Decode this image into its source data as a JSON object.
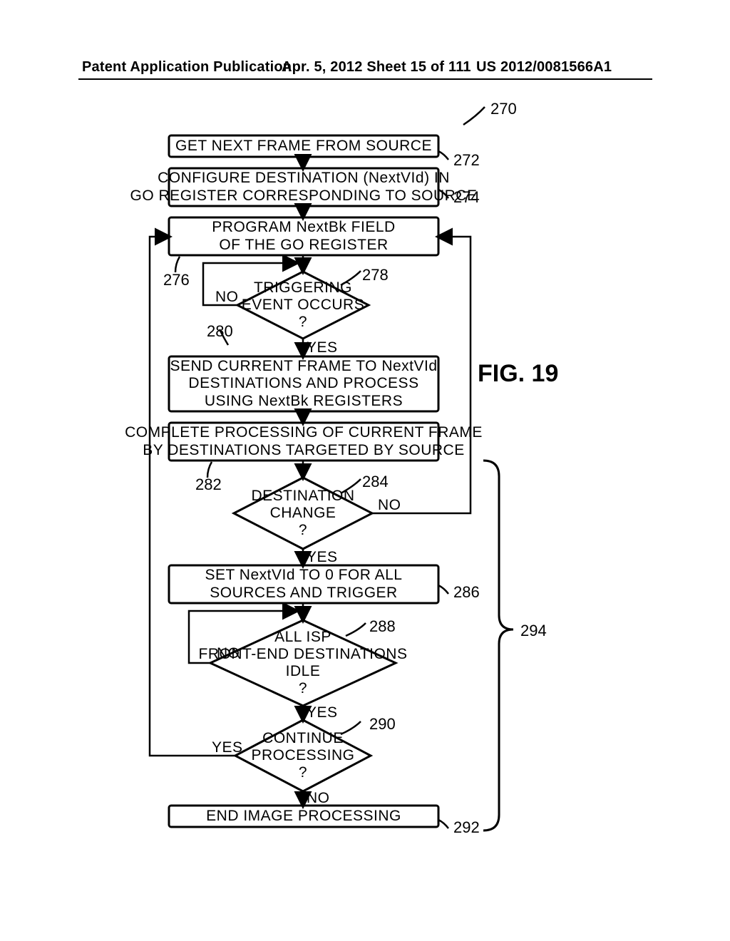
{
  "header": {
    "left": "Patent Application Publication",
    "mid": "Apr. 5, 2012  Sheet 15 of 111",
    "right": "US 2012/0081566A1"
  },
  "figure_label": "FIG. 19",
  "refs": {
    "r270": "270",
    "r272": "272",
    "r274": "274",
    "r276": "276",
    "r278": "278",
    "r280": "280",
    "r282": "282",
    "r284": "284",
    "r286": "286",
    "r288": "288",
    "r290": "290",
    "r292": "292",
    "r294": "294"
  },
  "steps": {
    "s272": "GET NEXT FRAME FROM SOURCE",
    "s274": "CONFIGURE DESTINATION (NextVId) IN\nGO REGISTER CORRESPONDING TO SOURCE",
    "s276": "PROGRAM NextBk FIELD\nOF THE GO REGISTER",
    "d278": "TRIGGERING\nEVENT OCCURS\n?",
    "s280": "SEND CURRENT FRAME TO NextVId\nDESTINATIONS AND PROCESS\nUSING NextBk REGISTERS",
    "s282": "COMPLETE PROCESSING OF CURRENT FRAME\nBY DESTINATIONS TARGETED BY SOURCE",
    "d284": "DESTINATION\nCHANGE\n?",
    "s286": "SET NextVId TO 0 FOR ALL\nSOURCES AND TRIGGER",
    "d288": "ALL ISP\nFRONT-END DESTINATIONS\nIDLE\n?",
    "d290": "CONTINUE\nPROCESSING\n?",
    "s292": "END IMAGE PROCESSING",
    "yes": "YES",
    "no": "NO"
  },
  "chart_data": {
    "type": "table",
    "description": "Flowchart for image processing frame handling in an ISP front-end, as depicted in FIG. 19 of US 2012/0081566A1.",
    "nodes": [
      {
        "id": 272,
        "type": "process",
        "text": "GET NEXT FRAME FROM SOURCE"
      },
      {
        "id": 274,
        "type": "process",
        "text": "CONFIGURE DESTINATION (NextVId) IN GO REGISTER CORRESPONDING TO SOURCE"
      },
      {
        "id": 276,
        "type": "process",
        "text": "PROGRAM NextBk FIELD OF THE GO REGISTER"
      },
      {
        "id": 278,
        "type": "decision",
        "text": "TRIGGERING EVENT OCCURS ?"
      },
      {
        "id": 280,
        "type": "process",
        "text": "SEND CURRENT FRAME TO NextVId DESTINATIONS AND PROCESS USING NextBk REGISTERS"
      },
      {
        "id": 282,
        "type": "process",
        "text": "COMPLETE PROCESSING OF CURRENT FRAME BY DESTINATIONS TARGETED BY SOURCE"
      },
      {
        "id": 284,
        "type": "decision",
        "text": "DESTINATION CHANGE ?"
      },
      {
        "id": 286,
        "type": "process",
        "text": "SET NextVId TO 0 FOR ALL SOURCES AND TRIGGER"
      },
      {
        "id": 288,
        "type": "decision",
        "text": "ALL ISP FRONT-END DESTINATIONS IDLE ?"
      },
      {
        "id": 290,
        "type": "decision",
        "text": "CONTINUE PROCESSING ?"
      },
      {
        "id": 292,
        "type": "terminal",
        "text": "END IMAGE PROCESSING"
      }
    ],
    "edges": [
      {
        "from": 272,
        "to": 274,
        "label": ""
      },
      {
        "from": 274,
        "to": 276,
        "label": ""
      },
      {
        "from": 276,
        "to": 278,
        "label": ""
      },
      {
        "from": 278,
        "to": 276,
        "label": "NO"
      },
      {
        "from": 278,
        "to": 280,
        "label": "YES"
      },
      {
        "from": 280,
        "to": 282,
        "label": ""
      },
      {
        "from": 282,
        "to": 284,
        "label": ""
      },
      {
        "from": 284,
        "to": 276,
        "label": "NO",
        "note": "loop back to 276 via right side"
      },
      {
        "from": 284,
        "to": 286,
        "label": "YES"
      },
      {
        "from": 286,
        "to": 288,
        "label": ""
      },
      {
        "from": 288,
        "to": 286,
        "label": "NO",
        "note": "loop back to 286 entry"
      },
      {
        "from": 288,
        "to": 290,
        "label": "YES"
      },
      {
        "from": 290,
        "to": 276,
        "label": "YES",
        "note": "loop back to 276 via far left side"
      },
      {
        "from": 290,
        "to": 292,
        "label": "NO"
      }
    ],
    "group": {
      "id": 294,
      "members": [
        284,
        286,
        288,
        290,
        292
      ],
      "note": "bracket on right groups lower portion of flow"
    },
    "entry_ref": 270
  }
}
